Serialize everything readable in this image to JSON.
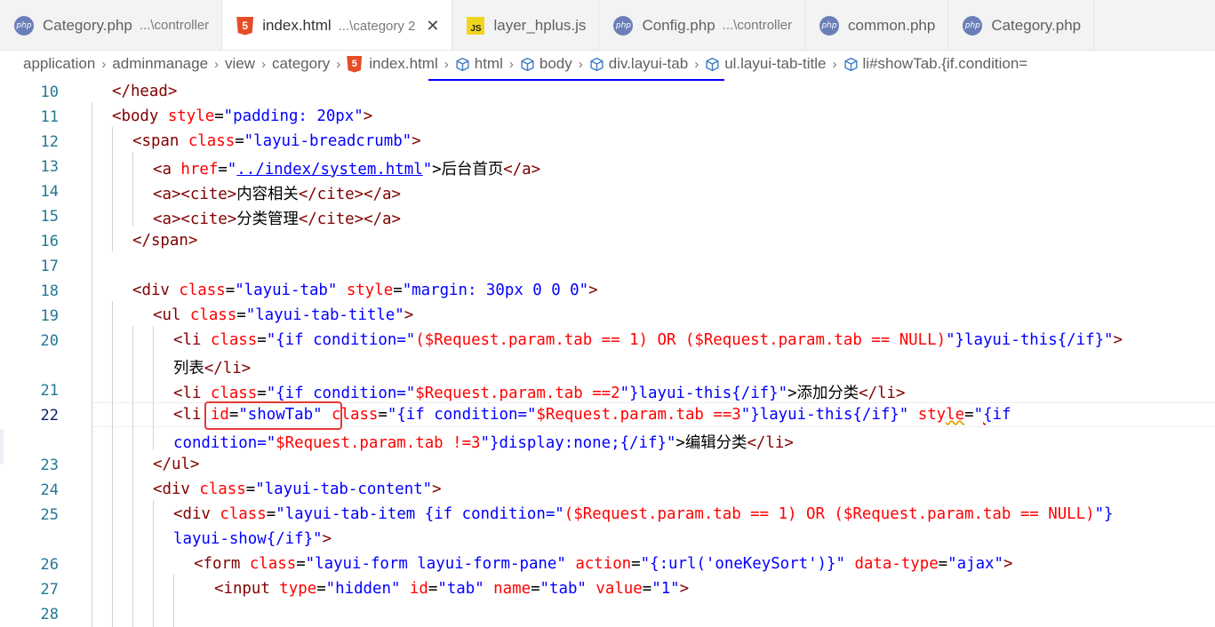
{
  "tabs": [
    {
      "icon": "php-icon",
      "label": "Category.php",
      "desc": "...\\controller",
      "active": false
    },
    {
      "icon": "html-icon",
      "label": "index.html",
      "desc": "...\\category 2",
      "active": true
    },
    {
      "icon": "js-icon",
      "label": "layer_hplus.js",
      "desc": "",
      "active": false
    },
    {
      "icon": "php-icon",
      "label": "Config.php",
      "desc": "...\\controller",
      "active": false
    },
    {
      "icon": "php-icon",
      "label": "common.php",
      "desc": "",
      "active": false
    },
    {
      "icon": "php-icon",
      "label": "Category.php",
      "desc": "",
      "active": false
    }
  ],
  "icon_text": {
    "php": "php",
    "html": "5",
    "js": "JS",
    "close": "✕"
  },
  "breadcrumb": [
    "application",
    "adminmanage",
    "view",
    "category",
    "index.html",
    "html",
    "body",
    "div.layui-tab",
    "ul.layui-tab-title",
    "li#showTab.{if.condition="
  ],
  "breadcrumb_sep": "›",
  "line_numbers": [
    "10",
    "11",
    "12",
    "13",
    "14",
    "15",
    "16",
    "17",
    "18",
    "19",
    "20",
    "21",
    "22",
    "23",
    "24",
    "25",
    "26",
    "27",
    "28"
  ],
  "code": {
    "l10": [
      "</head>"
    ],
    "l11": [
      "<body",
      " style",
      "=",
      "\"padding: 20px\"",
      ">"
    ],
    "l12": [
      "<span",
      " class",
      "=",
      "\"layui-breadcrumb\"",
      ">"
    ],
    "l13": [
      "<a",
      " href",
      "=",
      "\"",
      "../index/system.html",
      "\"",
      ">后台首页",
      "</a>"
    ],
    "l14": [
      "<a><cite>",
      "内容相关",
      "</cite></a>"
    ],
    "l15": [
      "<a><cite>",
      "分类管理",
      "</cite></a>"
    ],
    "l16": [
      "</span>"
    ],
    "l18": [
      "<div",
      " class",
      "=",
      "\"layui-tab\"",
      " style",
      "=",
      "\"margin: 30px 0 0 0\"",
      ">"
    ],
    "l19": [
      "<ul",
      " class",
      "=",
      "\"layui-tab-title\"",
      ">"
    ],
    "l20a": [
      "<li",
      " class",
      "=",
      "\"{if condition=\"",
      "($Request.param.tab == 1) OR ($Request.param.tab == NULL)",
      "\"}layui-this{/if}\"",
      ">"
    ],
    "l20b": [
      "列表",
      "</li>"
    ],
    "l21": [
      "<li",
      " class",
      "=",
      "\"{if condition=\"",
      "$Request.param.tab ==2",
      "\"}layui-this{/if}\"",
      ">添加分类",
      "</li>"
    ],
    "l22a": [
      "<li",
      " id",
      "=",
      "\"showTab\"",
      " class",
      "=",
      "\"",
      "{if condition=\"",
      "$Request.param.tab ==3",
      "\"",
      "}layui-this{/if}\"",
      " sty",
      "le",
      "=",
      "\"",
      "{",
      "if"
    ],
    "l22b": [
      "condition=\"",
      "$Request.param.tab !=3",
      "\"}display:none;{/if}\"",
      ">编辑分类",
      "</li>"
    ],
    "l23": [
      "</ul>"
    ],
    "l24": [
      "<div",
      " class",
      "=",
      "\"layui-tab-content\"",
      ">"
    ],
    "l25a": [
      "<div",
      " class",
      "=",
      "\"layui-tab-item {if condition=\"",
      "($Request.param.tab == 1) OR ($Request.param.tab == NULL)",
      "\"}"
    ],
    "l25b": [
      "layui-show{/if}\"",
      ">"
    ],
    "l26": [
      "<form",
      " class",
      "=",
      "\"layui-form layui-form-pane\"",
      " action",
      "=",
      "\"{:url('oneKeySort')}\"",
      " data-type",
      "=",
      "\"ajax\"",
      ">"
    ],
    "l27": [
      "<input",
      " type",
      "=",
      "\"hidden\"",
      " id",
      "=",
      "\"tab\"",
      " name",
      "=",
      "\"tab\"",
      " value",
      "=",
      "\"1\"",
      ">"
    ]
  }
}
